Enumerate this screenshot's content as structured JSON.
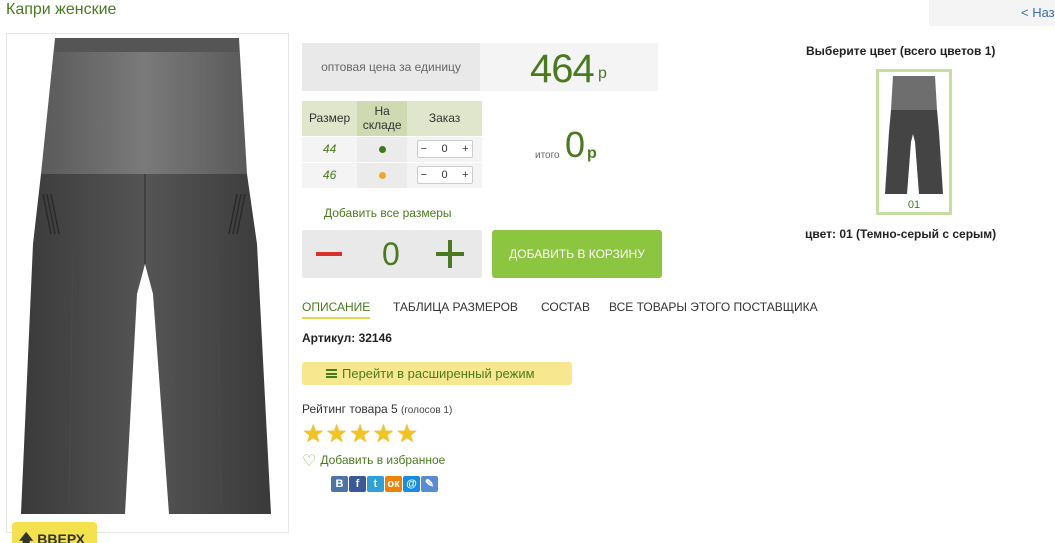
{
  "header": {
    "title": "Капри женские",
    "back_link": "< Назад"
  },
  "price": {
    "label": "оптовая цена за единицу",
    "value": "464",
    "currency": "р"
  },
  "size_table": {
    "headers": [
      "Размер",
      "На складе",
      "Заказ"
    ],
    "rows": [
      {
        "size": "44",
        "stock_color": "#3b7a1e",
        "qty": "0"
      },
      {
        "size": "46",
        "stock_color": "#f5a623",
        "qty": "0"
      }
    ]
  },
  "total": {
    "label": "итого",
    "value": "0",
    "currency": "р"
  },
  "add_all_sizes": "Добавить все размеры",
  "quantity": {
    "value": "0"
  },
  "cart_button": "ДОБАВИТЬ В КОРЗИНУ",
  "tabs": [
    {
      "label": "ОПИСАНИЕ",
      "active": true
    },
    {
      "label": "ТАБЛИЦА РАЗМЕРОВ",
      "active": false
    },
    {
      "label": "СОСТАВ",
      "active": false
    },
    {
      "label": "ВСЕ ТОВАРЫ ЭТОГО ПОСТАВЩИКА",
      "active": false
    }
  ],
  "sku": {
    "label": "Артикул:",
    "value": "32146"
  },
  "advanced_mode": "Перейти в расширенный режим",
  "rating": {
    "label": "Рейтинг товара 5",
    "votes": "(голосов 1)",
    "stars": 5
  },
  "favorite": "Добавить в избранное",
  "social": [
    {
      "icon": "vk-icon",
      "text": "В",
      "color": "#4c75a3"
    },
    {
      "icon": "facebook-icon",
      "text": "f",
      "color": "#3b5998"
    },
    {
      "icon": "twitter-icon",
      "text": "t",
      "color": "#2ea1d8"
    },
    {
      "icon": "odnoklassniki-icon",
      "text": "ок",
      "color": "#ee8208"
    },
    {
      "icon": "mailru-icon",
      "text": "@",
      "color": "#168de2"
    },
    {
      "icon": "livejournal-icon",
      "text": "✎",
      "color": "#5c8bd6"
    }
  ],
  "colors": {
    "title": "Выберите цвет (всего цветов 1)",
    "items": [
      {
        "code": "01"
      }
    ],
    "selected_caption": "цвет: 01 (Темно-серый с серым)"
  },
  "up_button": "ВВЕРХ",
  "accent_color": "#4a7a1e",
  "cart_color": "#8cc53f"
}
